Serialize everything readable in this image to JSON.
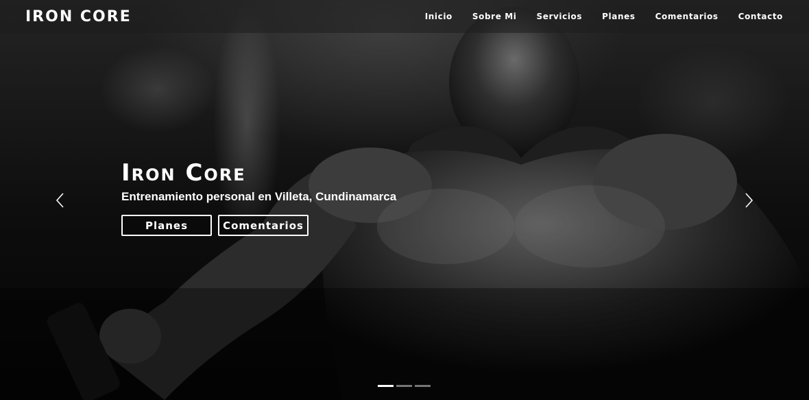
{
  "navbar": {
    "brand": "IRON CORE",
    "links": [
      {
        "label": "Inicio"
      },
      {
        "label": "Sobre Mi"
      },
      {
        "label": "Servicios"
      },
      {
        "label": "Planes"
      },
      {
        "label": "Comentarios"
      },
      {
        "label": "Contacto"
      }
    ]
  },
  "hero": {
    "title": "Iron Core",
    "subtitle": "Entrenamiento personal en Villeta, Cundinamarca",
    "buttons": {
      "planes": "Planes",
      "comentarios": "Comentarios"
    },
    "prev_icon": "chevron-left-icon",
    "next_icon": "chevron-right-icon",
    "slides_total": 3,
    "active_slide": 1
  },
  "colors": {
    "text": "#ffffff",
    "navbar_bg": "rgba(30,30,30,0.55)",
    "indicator_inactive": "rgba(255,255,255,0.45)"
  }
}
